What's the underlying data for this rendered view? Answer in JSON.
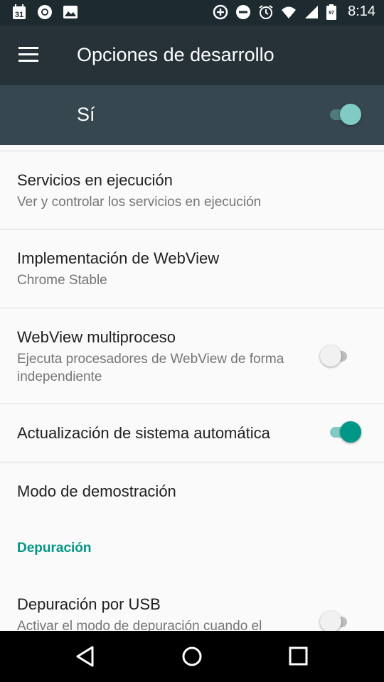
{
  "status_bar": {
    "time": "8:14",
    "calendar_day": "31",
    "battery_level": "97",
    "icons": [
      "calendar-icon",
      "chrome-icon",
      "photo-icon",
      "data-saver-icon",
      "do-not-disturb-icon",
      "alarm-icon",
      "wifi-icon",
      "cell-signal-icon",
      "battery-icon"
    ]
  },
  "toolbar": {
    "title": "Opciones de desarrollo",
    "menu_icon": "menu-icon"
  },
  "master_switch": {
    "label": "Sí",
    "state": "on"
  },
  "items": [
    {
      "title": "Servicios en ejecución",
      "summary": "Ver y controlar los servicios en ejecución"
    },
    {
      "title": "Implementación de WebView",
      "summary": "Chrome Stable"
    },
    {
      "title": "WebView multiproceso",
      "summary": "Ejecuta procesadores de WebView de forma independiente",
      "switch": "off"
    },
    {
      "title": "Actualización de sistema automática",
      "switch": "on"
    },
    {
      "title": "Modo de demostración"
    }
  ],
  "category": {
    "label": "Depuración"
  },
  "usb_item": {
    "title": "Depuración por USB",
    "summary": "Activar el modo de depuración cuando el",
    "switch": "off"
  },
  "nav_bar": {
    "icons": [
      "back-icon",
      "home-icon",
      "recents-icon"
    ]
  },
  "colors": {
    "accent": "#009688",
    "toolbar": "#263238",
    "master_bar": "#37474f",
    "status_bar": "#1d2a30"
  }
}
